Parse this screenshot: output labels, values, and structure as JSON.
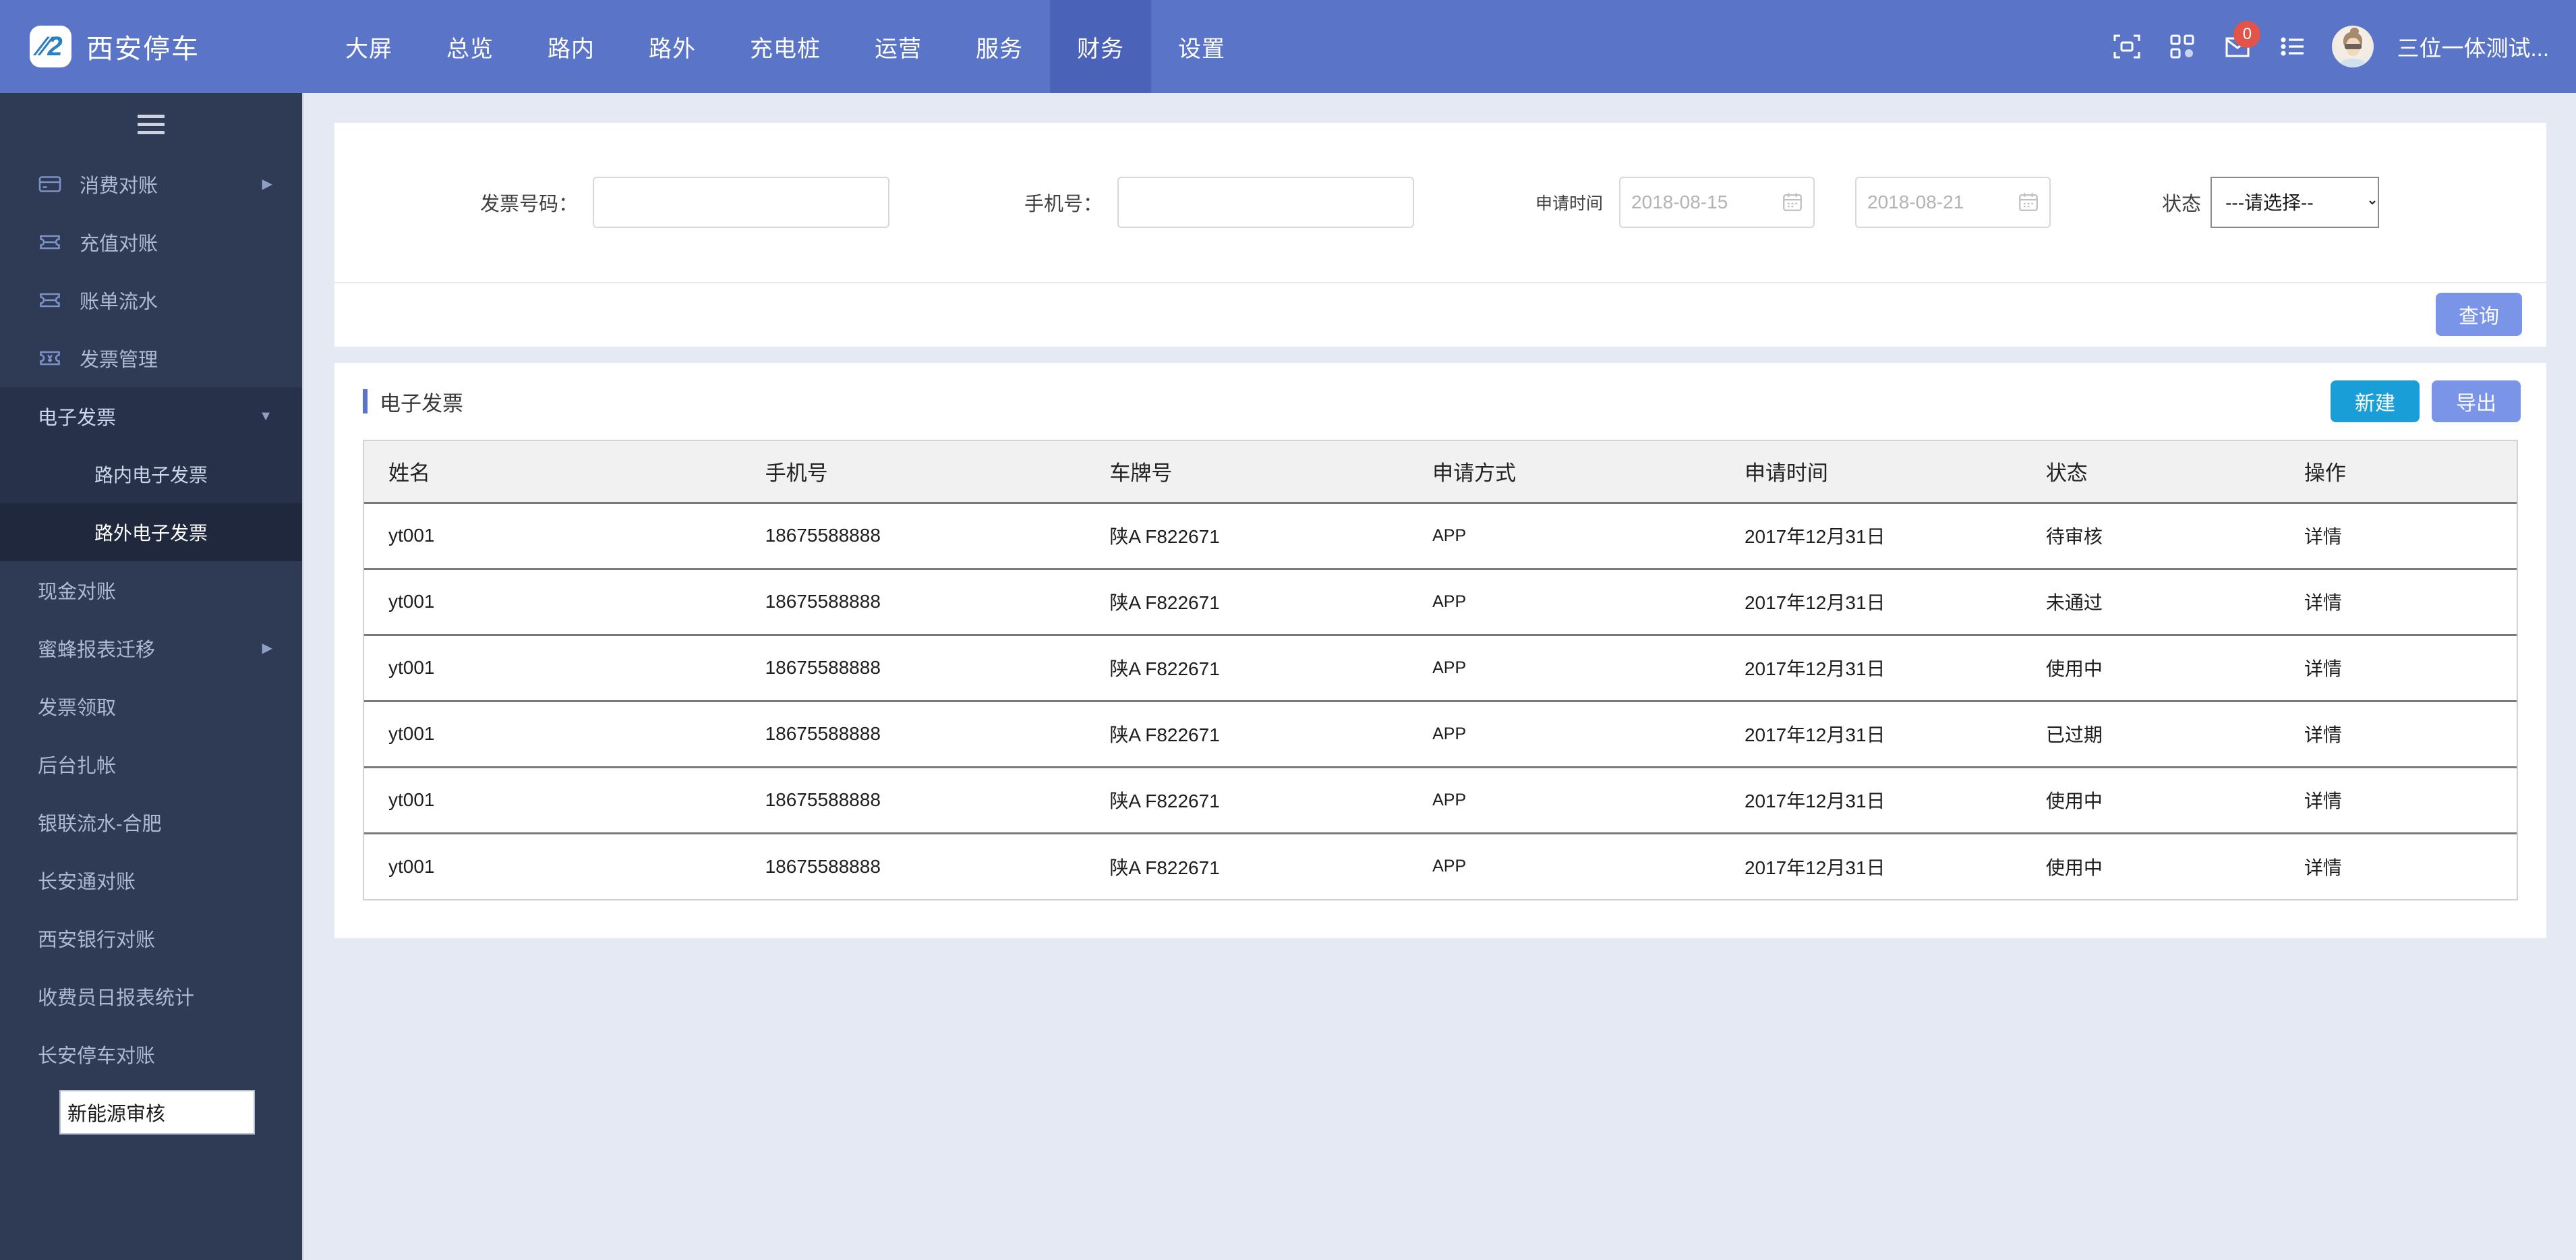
{
  "header": {
    "brand_title": "西安停车",
    "logo_icon": "parking-logo-icon",
    "nav": [
      {
        "label": "大屏",
        "active": false
      },
      {
        "label": "总览",
        "active": false
      },
      {
        "label": "路内",
        "active": false
      },
      {
        "label": "路外",
        "active": false
      },
      {
        "label": "充电桩",
        "active": false
      },
      {
        "label": "运营",
        "active": false
      },
      {
        "label": "服务",
        "active": false
      },
      {
        "label": "财务",
        "active": true
      },
      {
        "label": "设置",
        "active": false
      }
    ],
    "icons": {
      "scan": "scan-qr-icon",
      "apps": "grid-apps-icon",
      "message": "message-envelope-icon",
      "list": "list-menu-icon"
    },
    "message_badge": "0",
    "username": "三位一体测试..."
  },
  "sidebar": {
    "toggle_icon": "hamburger-menu-icon",
    "items": [
      {
        "label": "消费对账",
        "icon": "card-icon",
        "arrow": "▶",
        "type": "top"
      },
      {
        "label": "充值对账",
        "icon": "ticket-icon",
        "arrow": "",
        "type": "top"
      },
      {
        "label": "账单流水",
        "icon": "ticket-icon",
        "arrow": "",
        "type": "top"
      },
      {
        "label": "发票管理",
        "icon": "invoice-icon",
        "arrow": "",
        "type": "top"
      },
      {
        "label": "电子发票",
        "icon": "",
        "arrow": "▼",
        "type": "group"
      },
      {
        "label": "路内电子发票",
        "icon": "",
        "arrow": "",
        "type": "sub"
      },
      {
        "label": "路外电子发票",
        "icon": "",
        "arrow": "",
        "type": "sub-active"
      },
      {
        "label": "现金对账",
        "icon": "",
        "arrow": "",
        "type": "plain"
      },
      {
        "label": "蜜蜂报表迁移",
        "icon": "",
        "arrow": "▶",
        "type": "plain"
      },
      {
        "label": "发票领取",
        "icon": "",
        "arrow": "",
        "type": "plain"
      },
      {
        "label": "后台扎帐",
        "icon": "",
        "arrow": "",
        "type": "plain"
      },
      {
        "label": "银联流水-合肥",
        "icon": "",
        "arrow": "",
        "type": "plain"
      },
      {
        "label": "长安通对账",
        "icon": "",
        "arrow": "",
        "type": "plain"
      },
      {
        "label": "西安银行对账",
        "icon": "",
        "arrow": "",
        "type": "plain"
      },
      {
        "label": "收费员日报表统计",
        "icon": "",
        "arrow": "",
        "type": "plain"
      },
      {
        "label": "长安停车对账",
        "icon": "",
        "arrow": "",
        "type": "plain"
      }
    ],
    "edit_field_value": "新能源审核"
  },
  "filter": {
    "invoice_no_label": "发票号码：",
    "invoice_no_value": "",
    "invoice_no_placeholder": "",
    "phone_label": "手机号：",
    "phone_value": "",
    "phone_placeholder": "",
    "apply_time_label": "申请时间",
    "date_start_value": "",
    "date_start_placeholder": "2018-08-15",
    "date_end_value": "",
    "date_end_placeholder": "2018-08-21",
    "calendar_icon": "calendar-icon",
    "status_label": "状态",
    "status_selected": "---请选择--",
    "status_options": [
      "---请选择--"
    ],
    "query_button": "查询"
  },
  "table_panel": {
    "title": "电子发票",
    "new_button": "新建",
    "export_button": "导出",
    "columns": [
      "姓名",
      "手机号",
      "车牌号",
      "申请方式",
      "申请时间",
      "状态",
      "操作"
    ],
    "rows": [
      {
        "name": "yt001",
        "phone": "18675588888",
        "plate": "陕A F822671",
        "method": "APP",
        "time": "2017年12月31日",
        "status": "待审核",
        "action": "详情"
      },
      {
        "name": "yt001",
        "phone": "18675588888",
        "plate": "陕A F822671",
        "method": "APP",
        "time": "2017年12月31日",
        "status": "未通过",
        "action": "详情"
      },
      {
        "name": "yt001",
        "phone": "18675588888",
        "plate": "陕A F822671",
        "method": "APP",
        "time": "2017年12月31日",
        "status": "使用中",
        "action": "详情"
      },
      {
        "name": "yt001",
        "phone": "18675588888",
        "plate": "陕A F822671",
        "method": "APP",
        "time": "2017年12月31日",
        "status": "已过期",
        "action": "详情"
      },
      {
        "name": "yt001",
        "phone": "18675588888",
        "plate": "陕A F822671",
        "method": "APP",
        "time": "2017年12月31日",
        "status": "使用中",
        "action": "详情"
      },
      {
        "name": "yt001",
        "phone": "18675588888",
        "plate": "陕A F822671",
        "method": "APP",
        "time": "2017年12月31日",
        "status": "使用中",
        "action": "详情"
      }
    ]
  },
  "colors": {
    "header_blue": "#5a74c8",
    "header_active": "#4a63b8",
    "sidebar_navy": "#2f3a54",
    "sidebar_active": "#1f283d",
    "page_bg": "#e4e9f4",
    "accent_cyan": "#199ed8",
    "accent_periwinkle": "#7a94e8",
    "badge_red": "#e2544a"
  }
}
